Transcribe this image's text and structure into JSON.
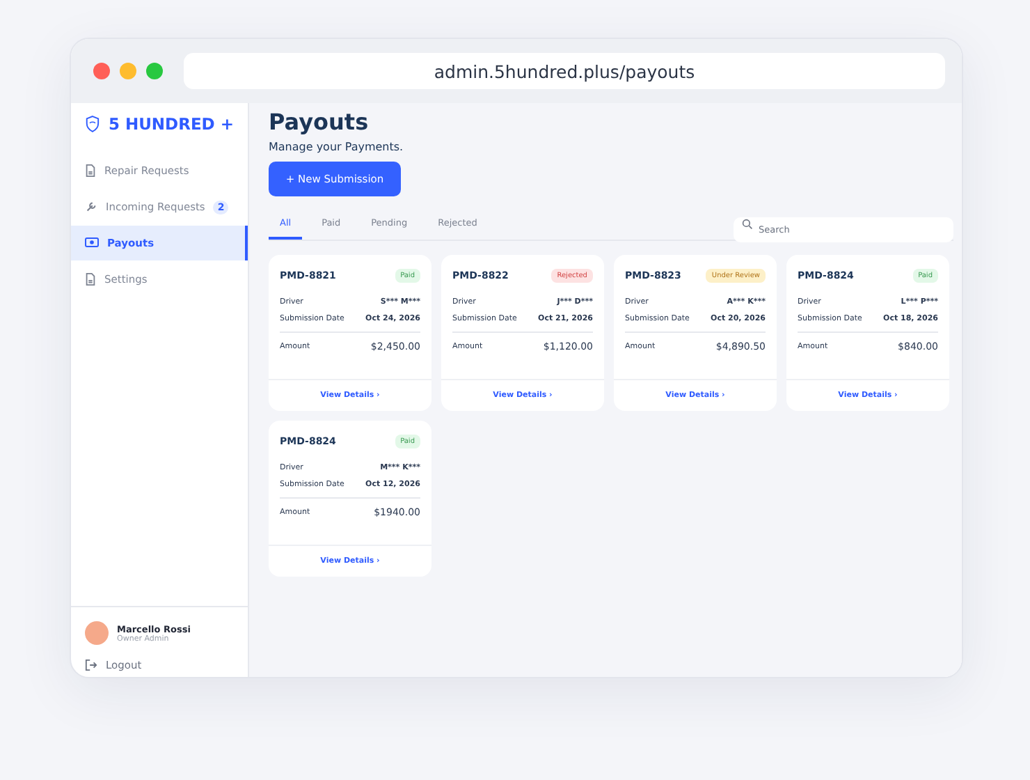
{
  "browser": {
    "url": "admin.5hundred.plus/payouts"
  },
  "sidebar": {
    "logo": "5 HUNDRED +",
    "items": [
      {
        "label": "Repair Requests",
        "selected": false
      },
      {
        "label": "Incoming Requests",
        "badge": "2",
        "selected": false
      },
      {
        "label": "Payouts",
        "selected": true
      },
      {
        "label": "Settings",
        "selected": false
      }
    ],
    "user": {
      "name": "Marcello Rossi",
      "role": "Owner Admin"
    },
    "logout": "Logout"
  },
  "page": {
    "title": "Payouts",
    "subtitle": "Manage your Payments.",
    "new_button": "+ New Submission",
    "tabs": [
      {
        "label": "All",
        "selected": true
      },
      {
        "label": "Paid",
        "selected": false
      },
      {
        "label": "Pending",
        "selected": false
      },
      {
        "label": "Rejected",
        "selected": false
      }
    ],
    "search": {
      "placeholder": "Search"
    },
    "cards": [
      {
        "id": "PMD-8821",
        "status": "Paid",
        "kind": "paid",
        "driver_label": "Driver",
        "driver": "S*** M***",
        "date_label": "Submission Date",
        "date": "Oct 24, 2026",
        "amount_label": "Amount",
        "amount": "$2,450.00",
        "link": "View Details ›"
      },
      {
        "id": "PMD-8822",
        "status": "Rejected",
        "kind": "rejected",
        "driver_label": "Driver",
        "driver": "J*** D***",
        "date_label": "Submission Date",
        "date": "Oct 21, 2026",
        "amount_label": "Amount",
        "amount": "$1,120.00",
        "link": "View Details ›"
      },
      {
        "id": "PMD-8823",
        "status": "Under Review",
        "kind": "review",
        "driver_label": "Driver",
        "driver": "A*** K***",
        "date_label": "Submission Date",
        "date": "Oct 20, 2026",
        "amount_label": "Amount",
        "amount": "$4,890.50",
        "link": "View Details ›"
      },
      {
        "id": "PMD-8824",
        "status": "Paid",
        "kind": "paid",
        "driver_label": "Driver",
        "driver": "L*** P***",
        "date_label": "Submission Date",
        "date": "Oct 18, 2026",
        "amount_label": "Amount",
        "amount": "$840.00",
        "link": "View Details ›"
      },
      {
        "id": "PMD-8824",
        "status": "Paid",
        "kind": "paid",
        "driver_label": "Driver",
        "driver": "M*** K***",
        "date_label": "Submission Date",
        "date": "Oct 12, 2026",
        "amount_label": "Amount",
        "amount": "$1940.00",
        "link": "View Details ›"
      }
    ]
  }
}
